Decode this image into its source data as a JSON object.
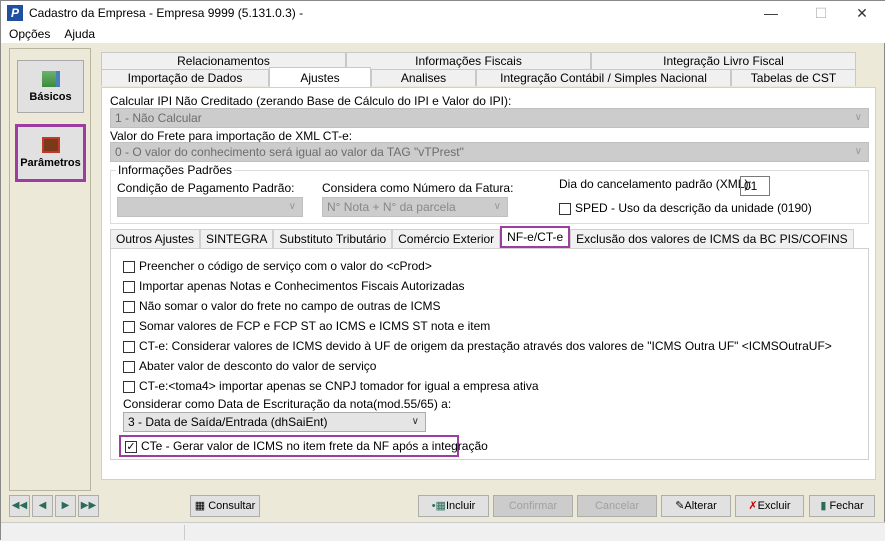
{
  "window": {
    "title": "Cadastro da Empresa - Empresa 9999 (5.131.0.3) -",
    "app_icon": "P"
  },
  "menu": [
    "Opções",
    "Ajuda"
  ],
  "sidebar": [
    {
      "label": "Básicos",
      "icon": "basics-icon"
    },
    {
      "label": "Parâmetros",
      "icon": "book-icon"
    }
  ],
  "tabs_row1": [
    "Relacionamentos",
    "Informações Fiscais",
    "Integração Livro Fiscal"
  ],
  "tabs_row2": [
    "Importação de Dados",
    "Ajustes",
    "Analises",
    "Integração Contábil / Simples Nacional",
    "Tabelas de CST"
  ],
  "active_tab": "Ajustes",
  "ajustes": {
    "ipi_label": "Calcular IPI Não Creditado (zerando Base de Cálculo do IPI e Valor do IPI):",
    "ipi_value": "1 - Não Calcular",
    "frete_label": "Valor do Frete para importação de XML CT-e:",
    "frete_value": "0 - O valor do conhecimento será igual ao valor da TAG \"vTPrest\"",
    "group_title": "Informações Padrões",
    "cond_pag_label": "Condição de Pagamento Padrão:",
    "cond_pag_value": "",
    "num_fatura_label": "Considera como Número da Fatura:",
    "num_fatura_value": "N° Nota + N° da parcela",
    "dia_cancel_label": "Dia do cancelamento padrão (XML):",
    "dia_cancel_value": "01",
    "sped_label": "SPED - Uso da descrição da unidade (0190)"
  },
  "subtabs": [
    "Outros Ajustes",
    "SINTEGRA",
    "Substituto Tributário",
    "Comércio Exterior",
    "NF-e/CT-e",
    "Exclusão dos valores de ICMS da BC PIS/COFINS"
  ],
  "active_subtab": "NF-e/CT-e",
  "nfe": {
    "options": [
      {
        "label": "Preencher o código de serviço com o valor do <cProd>",
        "checked": false
      },
      {
        "label": "Importar apenas Notas e Conhecimentos Fiscais Autorizadas",
        "checked": false
      },
      {
        "label": "Não somar o valor do frete no campo de outras de ICMS",
        "checked": false
      },
      {
        "label": "Somar valores de FCP e FCP ST ao ICMS e ICMS ST nota e item",
        "checked": false
      },
      {
        "label": "CT-e: Considerar valores de ICMS devido à UF de origem da prestação através dos valores de \"ICMS Outra UF\" <ICMSOutraUF>",
        "checked": false
      },
      {
        "label": "Abater valor de desconto do valor de serviço",
        "checked": false
      },
      {
        "label": "CT-e:<toma4> importar apenas se CNPJ tomador for igual a empresa ativa",
        "checked": false
      }
    ],
    "data_escrit_label": "Considerar como Data de Escrituração da nota(mod.55/65) a:",
    "data_escrit_value": "3 -  Data de Saída/Entrada (dhSaiEnt)",
    "cte_label": "CTe - Gerar valor de ICMS no item frete da NF após a integração",
    "cte_checked": true
  },
  "footer": {
    "consultar": "Consultar",
    "incluir": "Incluir",
    "confirmar": "Confirmar",
    "cancelar": "Cancelar",
    "alterar": "Alterar",
    "excluir": "Excluir",
    "fechar": "Fechar"
  },
  "colors": {
    "highlight": "#9b3ea0",
    "window_bg": "#ece9d8"
  }
}
